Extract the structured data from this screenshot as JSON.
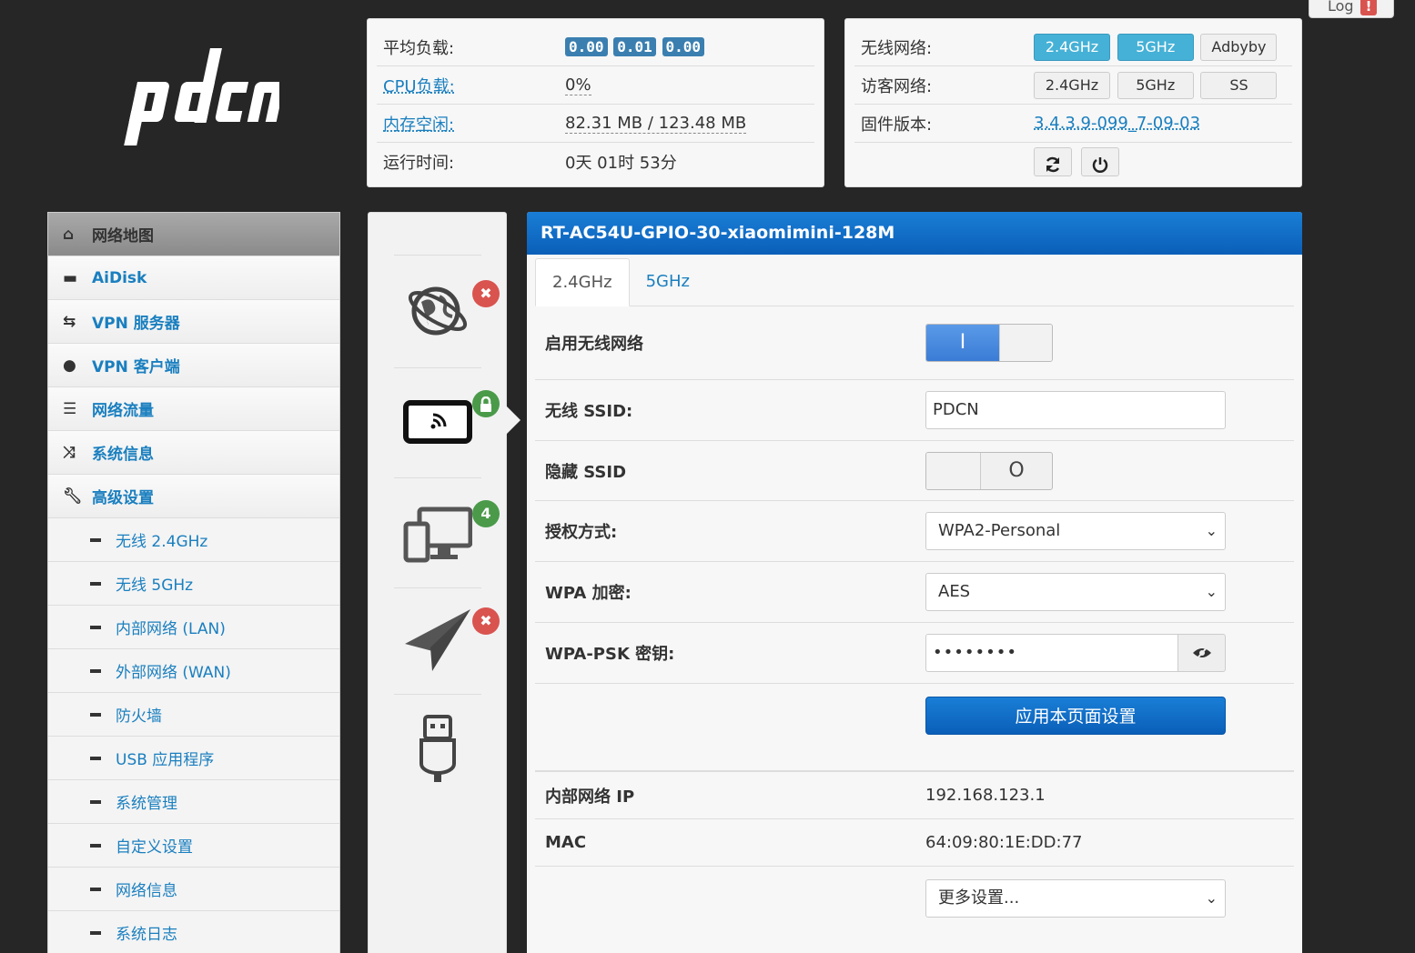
{
  "log": {
    "label": "Log",
    "alert": "!"
  },
  "load_panel": {
    "rows": [
      {
        "label": "平均负载:",
        "badges": [
          "0.00",
          "0.01",
          "0.00"
        ]
      },
      {
        "label": "CPU负载:",
        "value": "0%"
      },
      {
        "label": "内存空闲:",
        "value": "82.31 MB / 123.48 MB"
      },
      {
        "label": "运行时间:",
        "value": "0天 01时 53分"
      }
    ]
  },
  "wifi_panel": {
    "wireless_label": "无线网络:",
    "wireless_buttons": [
      "2.4GHz",
      "5GHz",
      "Adbyby"
    ],
    "guest_label": "访客网络:",
    "guest_buttons": [
      "2.4GHz",
      "5GHz",
      "SS"
    ],
    "firmware_label": "固件版本:",
    "firmware_value": "3.4.3.9-099_7-09-03",
    "refresh_icon": "refresh-icon",
    "power_icon": "power-icon"
  },
  "sidebar": {
    "items": [
      {
        "label": "网络地图",
        "icon": "home-icon",
        "current": true
      },
      {
        "label": "AiDisk",
        "icon": "hdd-icon"
      },
      {
        "label": "VPN 服务器",
        "icon": "retweet-icon"
      },
      {
        "label": "VPN 客户端",
        "icon": "globe-icon"
      },
      {
        "label": "网络流量",
        "icon": "tasks-icon"
      },
      {
        "label": "系统信息",
        "icon": "random-icon"
      },
      {
        "label": "高级设置",
        "icon": "wrench-icon"
      }
    ],
    "subitems": [
      "无线 2.4GHz",
      "无线 5GHz",
      "内部网络 (LAN)",
      "外部网络 (WAN)",
      "防火墙",
      "USB 应用程序",
      "系统管理",
      "自定义设置",
      "网络信息",
      "系统日志"
    ]
  },
  "rail": {
    "badges": {
      "internet": "✖",
      "wireless": "lock",
      "clients": "4",
      "vpn": "✖"
    }
  },
  "main": {
    "title": "RT-AC54U-GPIO-30-xiaomimini-128M",
    "tabs": [
      "2.4GHz",
      "5GHz"
    ],
    "enable_label": "启用无线网络",
    "enable_on": "I",
    "ssid_label": "无线 SSID:",
    "ssid_value": "PDCN",
    "hide_label": "隐藏 SSID",
    "hide_off": "O",
    "auth_label": "授权方式:",
    "auth_value": "WPA2-Personal",
    "enc_label": "WPA 加密:",
    "enc_value": "AES",
    "psk_label": "WPA-PSK 密钥:",
    "psk_value": "••••••••",
    "apply_label": "应用本页面设置",
    "lan_ip_label": "内部网络 IP",
    "lan_ip_value": "192.168.123.1",
    "mac_label": "MAC",
    "mac_value": "64:09:80:1E:DD:77",
    "more_value": "更多设置..."
  }
}
